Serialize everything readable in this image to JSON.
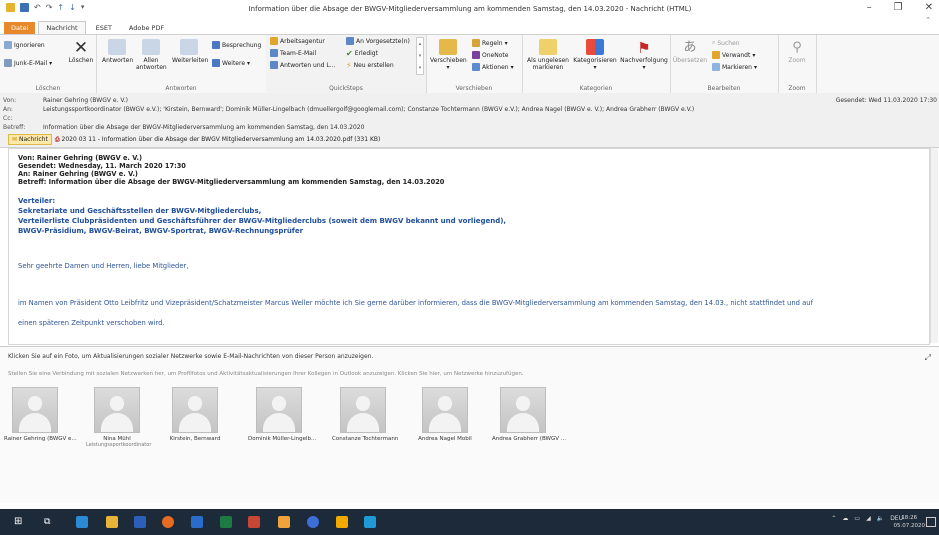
{
  "window": {
    "title": "Information über die Absage der BWGV-Mitgliederversammlung am kommenden Samstag, den 14.03.2020  -  Nachricht (HTML)",
    "help": "?"
  },
  "tabs": [
    "Datei",
    "Nachricht",
    "ESET",
    "Adobe PDF"
  ],
  "ribbon": {
    "groups": {
      "delete": "Löschen",
      "respond": "Antworten",
      "quicksteps": "QuickSteps",
      "move": "Verschieben",
      "tags": "Kategorien",
      "edit": "Bearbeiten",
      "zoom": "Zoom"
    },
    "ignore": "Ignorieren",
    "junk": "Junk-E-Mail",
    "delete_btn": "Löschen",
    "reply": "Antworten",
    "reply_all_1": "Allen",
    "reply_all_2": "antworten",
    "forward": "Weiterleiten",
    "meeting": "Besprechung",
    "more": "Weitere",
    "qs1": "Arbeitsagentur",
    "qs2": "Team-E-Mail",
    "qs3": "Antworten und L...",
    "qs4": "An Vorgesetzte(n)",
    "qs5": "Erledigt",
    "qs6": "Neu erstellen",
    "move_btn": "Verschieben",
    "rules": "Regeln",
    "onenote": "OneNote",
    "actions": "Aktionen",
    "unread_1": "Als ungelesen",
    "unread_2": "markieren",
    "categorize": "Kategorisieren",
    "followup": "Nachverfolgung",
    "translate": "Übersetzen",
    "find": "Suchen",
    "related": "Verwandt",
    "select": "Markieren",
    "zoom_btn": "Zoom"
  },
  "header": {
    "from_label": "Von:",
    "from": "Rainer Gehring (BWGV e. V.)",
    "to_label": "An:",
    "to": "Leistungssportkoordinator (BWGV e.V.); 'Kirstein, Bernward'; Dominik Müller-Lingelbach (dmuellergolf@googlemail.com); Constanze Tochtermann (BWGV e.V.); Andrea Nagel (BWGV e. V.); Andrea Grabherr (BWGV e.V.)",
    "cc_label": "Cc:",
    "subject_label": "Betreff:",
    "subject": "Information über die Absage der BWGV-Mitgliederversammlung am kommenden Samstag, den 14.03.2020",
    "sent_label": "Gesendet:",
    "sent": "Wed 11.03.2020 17:30",
    "attach_tab": "Nachricht",
    "attachment": "2020 03 11 - Information über die Absage der BWGV Mitgliederversammlung am 14.03.2020.pdf (331 KB)"
  },
  "body": {
    "l1": "Von: Rainer Gehring (BWGV e. V.)",
    "l2": "Gesendet: Wednesday, 11. March 2020 17:30",
    "l3": "An: Rainer Gehring (BWGV e. V.)",
    "l4": "Betreff: Information über die Absage der BWGV-Mitgliederversammlung am kommenden Samstag, den 14.03.2020",
    "v0": "Verteiler:",
    "v1": "Sekretariate und Geschäftsstellen der BWGV-Mitgliederclubs,",
    "v2": "Verteilerliste Clubpräsidenten und Geschäftsführer der BWGV-Mitgliederclubs (soweit dem BWGV bekannt und vorliegend),",
    "v3": "BWGV-Präsidium, BWGV-Beirat, BWGV-Sportrat, BWGV-Rechnungsprüfer",
    "greeting": "Sehr geehrte Damen und Herren, liebe Mitglieder,",
    "p1": "im Namen von Präsident Otto Leibfritz und Vizepräsident/Schatzmeister Marcus Weller möchte ich Sie gerne darüber informieren, dass die BWGV-Mitgliederversammlung am kommenden Samstag, den 14.03., nicht stattfindet und auf",
    "p2": "einen späteren Zeitpunkt verschoben wird."
  },
  "people": {
    "info1": "Klicken Sie auf ein Foto, um Aktualisierungen sozialer Netzwerke sowie E-Mail-Nachrichten von dieser Person anzuzeigen.",
    "info2": "Stellen Sie eine Verbindung mit sozialen Netzwerken her, um Profilfotos und Aktivitätsaktualisierungen Ihrer Kollegen in Outlook anzuzeigen. Klicken Sie hier, um Netzwerke hinzuzufügen.",
    "list": [
      {
        "name": "Rainer Gehring (BWGV e...",
        "role": ""
      },
      {
        "name": "Nina  Mühl",
        "role": "Leistungssportkoordinator"
      },
      {
        "name": "Kirstein, Bernward",
        "role": ""
      },
      {
        "name": "Dominik Müller-Lingelb...",
        "role": ""
      },
      {
        "name": "Constanze Tochtermann",
        "role": ""
      },
      {
        "name": "Andrea Nagel Mobil",
        "role": ""
      },
      {
        "name": "Andrea Grabherr (BWGV ...",
        "role": ""
      }
    ]
  },
  "taskbar": {
    "lang": "DEU",
    "time": "18:26",
    "date": "05.07.2020"
  },
  "colors": {
    "file_tab": "#e7882b",
    "taskbar": "#1d2a3a",
    "body_blue": "#1f4e9a"
  }
}
